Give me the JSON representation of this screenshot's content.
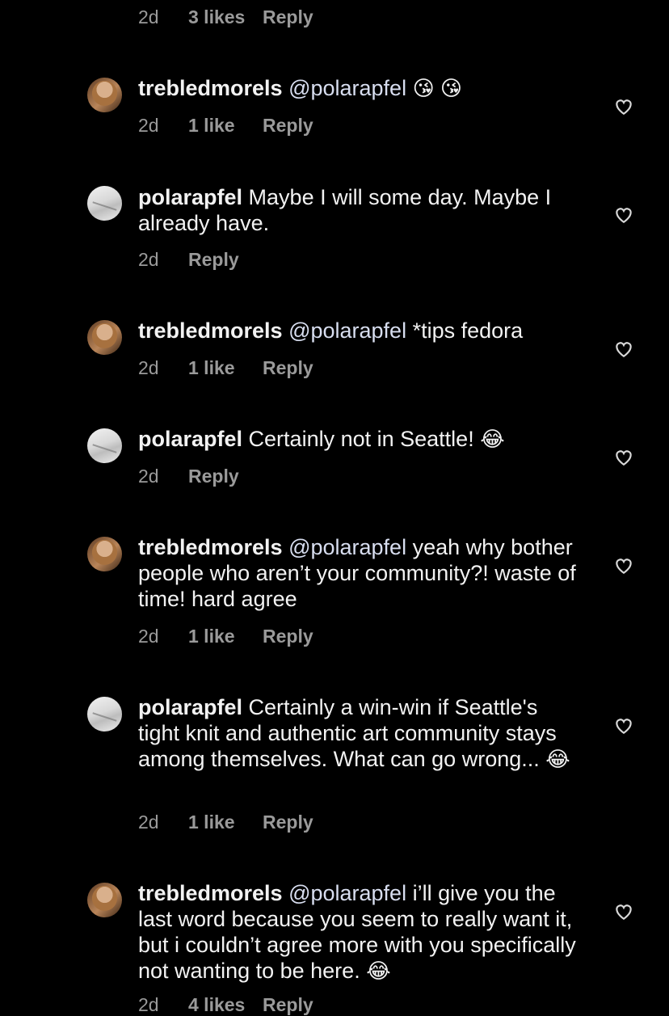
{
  "top_meta": {
    "time": "2d",
    "likes": "3 likes",
    "reply": "Reply"
  },
  "comments": [
    {
      "user": "trebledmorels",
      "mention": "@polarapfel",
      "body": "",
      "emoji": "😘 😘",
      "time": "2d",
      "likes": "1 like",
      "reply": "Reply",
      "avatar": "user1"
    },
    {
      "user": "polarapfel",
      "mention": "",
      "body": "Maybe I will some day. Maybe I already have.",
      "emoji": "",
      "time": "2d",
      "likes": "",
      "reply": "Reply",
      "avatar": "user2"
    },
    {
      "user": "trebledmorels",
      "mention": "@polarapfel",
      "body": "*tips fedora",
      "emoji": "",
      "time": "2d",
      "likes": "1 like",
      "reply": "Reply",
      "avatar": "user1"
    },
    {
      "user": "polarapfel",
      "mention": "",
      "body": "Certainly not in Seattle!",
      "emoji": "😂",
      "time": "2d",
      "likes": "",
      "reply": "Reply",
      "avatar": "user2"
    },
    {
      "user": "trebledmorels",
      "mention": "@polarapfel",
      "body": "yeah why bother people who aren’t your community?! waste of time! hard agree",
      "emoji": "",
      "time": "2d",
      "likes": "1 like",
      "reply": "Reply",
      "avatar": "user1"
    },
    {
      "user": "polarapfel",
      "mention": "",
      "body": "Certainly a win-win if Seattle's tight knit and authentic art community stays among themselves. What can go wrong...",
      "emoji": "😂",
      "time": "2d",
      "likes": "1 like",
      "reply": "Reply",
      "avatar": "user2"
    },
    {
      "user": "trebledmorels",
      "mention": "@polarapfel",
      "body": "i’ll give you the last word because you seem to really want it, but i couldn’t agree more with you specifically not wanting to be here.",
      "emoji": "😂",
      "time": "2d",
      "likes": "4 likes",
      "reply": "Reply",
      "avatar": "user1"
    }
  ],
  "icons": {
    "like": "heart-outline-icon"
  }
}
